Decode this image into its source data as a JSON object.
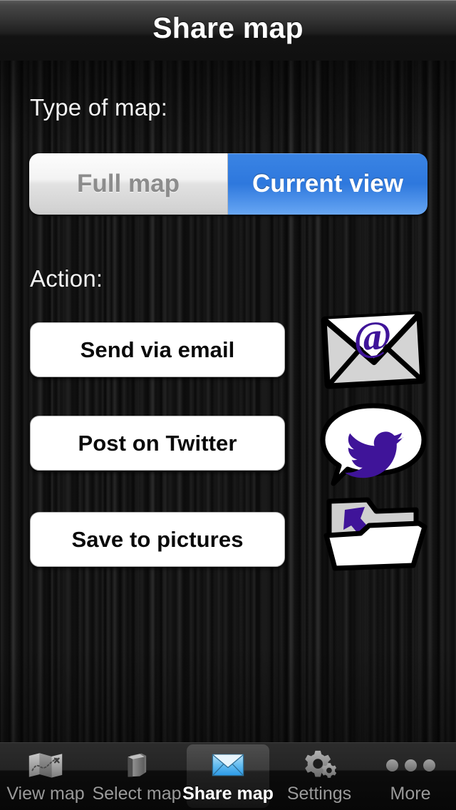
{
  "navbar": {
    "title": "Share map"
  },
  "main": {
    "type_label": "Type of map:",
    "action_label": "Action:",
    "segmented": {
      "name": "map-type",
      "selected_index": 1,
      "options": [
        {
          "label": "Full map",
          "selected": false
        },
        {
          "label": "Current view",
          "selected": true
        }
      ]
    },
    "actions": [
      {
        "label": "Send via email",
        "icon": "envelope-at-icon"
      },
      {
        "label": "Post on Twitter",
        "icon": "twitter-bird-speech-bubble-icon"
      },
      {
        "label": "Save to pictures",
        "icon": "folder-download-icon"
      }
    ]
  },
  "tabbar": {
    "selected_index": 2,
    "tabs": [
      {
        "label": "View map",
        "icon": "folded-map-icon",
        "selected": false
      },
      {
        "label": "Select map",
        "icon": "book-stack-icon",
        "selected": false
      },
      {
        "label": "Share map",
        "icon": "envelope-icon",
        "selected": true
      },
      {
        "label": "Settings",
        "icon": "gears-icon",
        "selected": false
      },
      {
        "label": "More",
        "icon": "ellipsis-icon",
        "selected": false
      }
    ]
  },
  "colors": {
    "accent_blue": "#2f79de",
    "icon_purple": "#3f1499",
    "background_dark": "#141414",
    "button_white": "#ffffff",
    "tab_selected_text": "#ffffff",
    "tab_text": "#9a9a9a"
  }
}
